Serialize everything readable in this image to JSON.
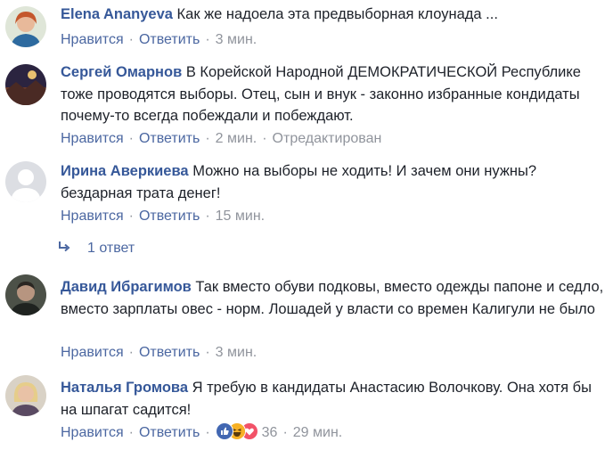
{
  "colors": {
    "author": "#365899",
    "link": "#4b67a1",
    "meta": "#90949c",
    "text": "#1d2129",
    "like_blue": "#4267b2",
    "haha_yellow": "#f7b125",
    "love_red": "#f25268"
  },
  "labels": {
    "like": "Нравится",
    "reply": "Ответить",
    "separator": "·"
  },
  "comments": [
    {
      "author": "Elena Ananyeva",
      "text": "Как же надоела эта предвыборная клоунада ...",
      "time": "3 мин."
    },
    {
      "author": "Сергей Омарнов",
      "text": "В Корейской Народной ДЕМОКРАТИЧЕСКОЙ Республике тоже проводятся выборы. Отец, сын и внук - законно избранные кондидаты почему-то всегда побеждали и побеждают.",
      "time": "2 мин.",
      "edited": "Отредактирован"
    },
    {
      "author": "Ирина Аверкиева",
      "text": "Можно на выборы не ходить! И зачем они нужны? бездарная трата денег!",
      "time": "15 мин.",
      "replies": "1 ответ"
    },
    {
      "author": "Давид Ибрагимов",
      "text": "Так вместо обуви подковы, вместо одежды папоне и седло, вместо зарплаты овес - норм. Лошадей у власти со времен Калигули не было",
      "time": "3 мин."
    },
    {
      "author": "Наталья Громова",
      "text": "Я требую в кандидаты Анастасию Волочкову. Она хотя бы на шпагат садится!",
      "time": "29 мин.",
      "reactions": {
        "icons": [
          "like-reaction-icon",
          "haha-reaction-icon",
          "love-reaction-icon"
        ],
        "count": "36"
      }
    }
  ]
}
